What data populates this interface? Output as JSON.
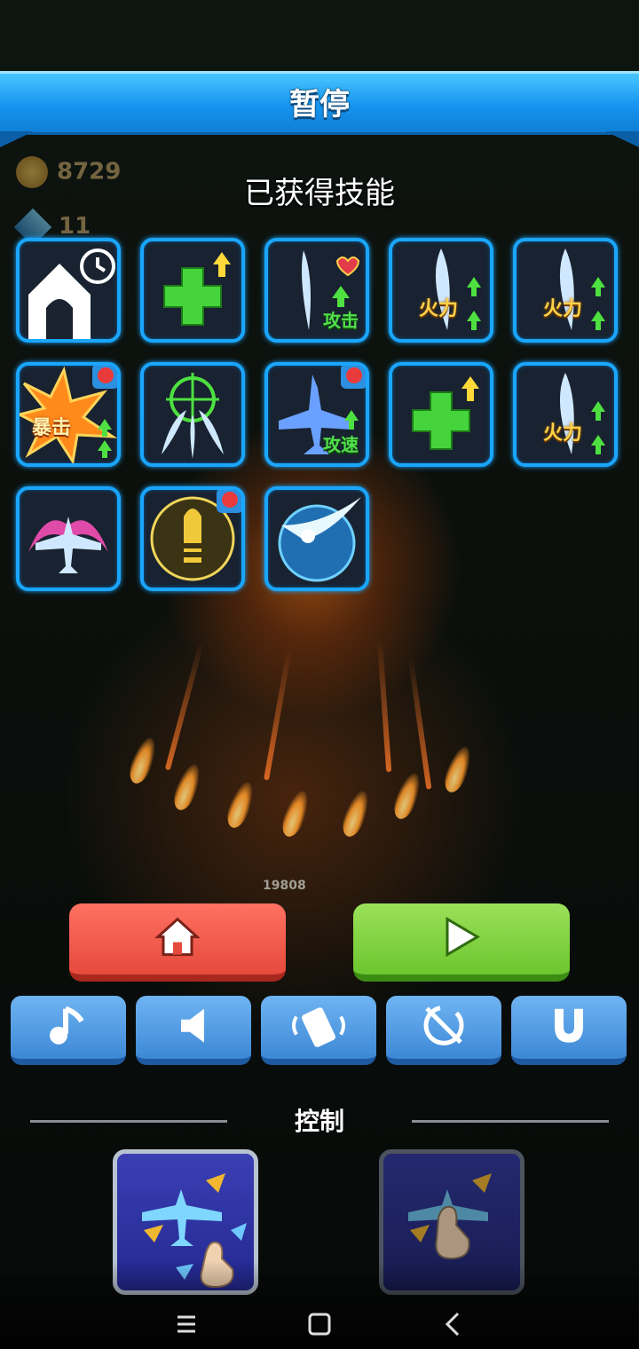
{
  "header": {
    "title": "暂停"
  },
  "stats": {
    "coins": "8729",
    "gems": "11"
  },
  "skills_label": "已获得技能",
  "score_popup": "19808",
  "skills": [
    {
      "name": "home-shield",
      "label": "",
      "badge": false
    },
    {
      "name": "heal-up",
      "label": "",
      "badge": false
    },
    {
      "name": "attack-up",
      "label": "攻击",
      "badge": false
    },
    {
      "name": "firepower-up",
      "label": "火力",
      "badge": false
    },
    {
      "name": "firepower-up",
      "label": "火力",
      "badge": false
    },
    {
      "name": "critical-up",
      "label": "暴击",
      "badge": true
    },
    {
      "name": "homing-missiles",
      "label": "",
      "badge": false
    },
    {
      "name": "attack-speed-up",
      "label": "攻速",
      "badge": true
    },
    {
      "name": "heal-up",
      "label": "",
      "badge": false
    },
    {
      "name": "firepower-up",
      "label": "火力",
      "badge": false
    },
    {
      "name": "wing-shield",
      "label": "",
      "badge": false
    },
    {
      "name": "bullet-upgrade",
      "label": "",
      "badge": true
    },
    {
      "name": "energy-orb",
      "label": "",
      "badge": false
    }
  ],
  "actions": {
    "home_icon": "home-icon",
    "play_icon": "play-icon"
  },
  "settings": [
    "music-note-icon",
    "speaker-icon",
    "vibration-icon",
    "no-rotate-icon",
    "magnet-icon"
  ],
  "control": {
    "label": "控制"
  },
  "colors": {
    "banner": "#1694f0",
    "tile_border": "#1aa6ff",
    "home_button": "#e64a3c",
    "play_button": "#6cc62e",
    "setting_button": "#3d88d6"
  }
}
